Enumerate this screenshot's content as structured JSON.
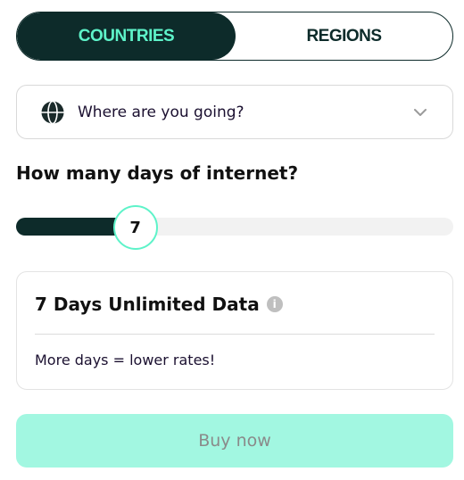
{
  "tabs": [
    {
      "label": "COUNTRIES",
      "active": true
    },
    {
      "label": "REGIONS",
      "active": false
    }
  ],
  "destination": {
    "placeholder": "Where are you going?",
    "icon": "globe-icon"
  },
  "days": {
    "question": "How many days of internet?",
    "value": "7",
    "fill_fraction": 0.238
  },
  "plan": {
    "title": "7 Days Unlimited Data",
    "info_icon": "i",
    "note": "More days = lower rates!"
  },
  "buy_button": {
    "label": "Buy now"
  },
  "colors": {
    "dark": "#0d2b2a",
    "accent": "#5ef3c9",
    "button_bg": "#a2f7e1",
    "button_text": "#8a8a8a"
  }
}
